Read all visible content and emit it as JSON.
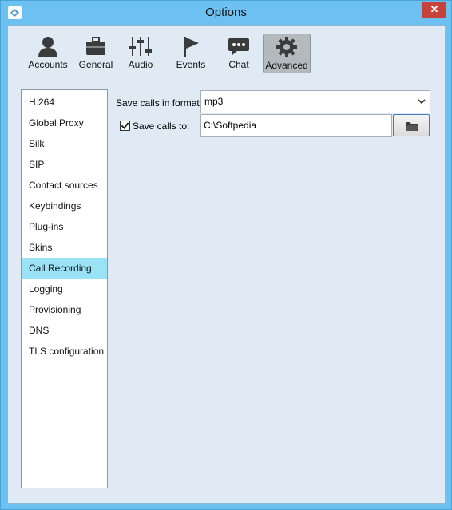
{
  "window": {
    "title": "Options",
    "close_glyph": "✕"
  },
  "toolbar": {
    "tabs": [
      {
        "label": "Accounts",
        "icon": "person-icon"
      },
      {
        "label": "General",
        "icon": "briefcase-icon"
      },
      {
        "label": "Audio",
        "icon": "mixer-sliders-icon"
      },
      {
        "label": "Events",
        "icon": "flag-icon"
      },
      {
        "label": "Chat",
        "icon": "chat-bubble-icon"
      },
      {
        "label": "Advanced",
        "icon": "gear-icon"
      }
    ],
    "active_tab": "Advanced"
  },
  "sidebar": {
    "items": [
      {
        "label": "H.264"
      },
      {
        "label": "Global Proxy"
      },
      {
        "label": "Silk"
      },
      {
        "label": "SIP"
      },
      {
        "label": "Contact sources"
      },
      {
        "label": "Keybindings"
      },
      {
        "label": "Plug-ins"
      },
      {
        "label": "Skins"
      },
      {
        "label": "Call Recording"
      },
      {
        "label": "Logging"
      },
      {
        "label": "Provisioning"
      },
      {
        "label": "DNS"
      },
      {
        "label": "TLS configuration"
      }
    ],
    "selected": "Call Recording"
  },
  "recording": {
    "format_label": "Save calls in format:",
    "format_value": "mp3",
    "save_label": "Save calls to:",
    "save_checked": true,
    "path_value": "C:\\Softpedia"
  },
  "colors": {
    "title_bar": "#6cc1f0",
    "selected_item": "#9ae2f6",
    "close_button": "#c7423a"
  }
}
